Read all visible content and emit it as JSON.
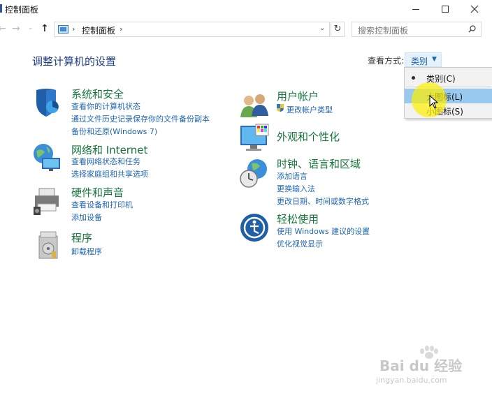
{
  "window": {
    "title": "控制面板"
  },
  "address": {
    "crumb": "控制面板",
    "search_placeholder": "搜索控制面板"
  },
  "header": {
    "title": "调整计算机的设置",
    "view_by_label": "查看方式:",
    "view_by_value": "类别"
  },
  "view_menu": {
    "items": [
      {
        "label": "类别(C)",
        "selected": true
      },
      {
        "label": "大图标(L)",
        "hovered": true
      },
      {
        "label": "小图标(S)"
      }
    ]
  },
  "categories": {
    "system": {
      "title": "系统和安全",
      "links": [
        "查看你的计算机状态",
        "通过文件历史记录保存你的文件备份副本",
        "备份和还原(Windows 7)"
      ]
    },
    "network": {
      "title": "网络和 Internet",
      "links": [
        "查看网络状态和任务",
        "选择家庭组和共享选项"
      ]
    },
    "hardware": {
      "title": "硬件和声音",
      "links": [
        "查看设备和打印机",
        "添加设备"
      ]
    },
    "programs": {
      "title": "程序",
      "links": [
        "卸载程序"
      ]
    },
    "accounts": {
      "title": "用户帐户",
      "links": [
        "更改帐户类型"
      ]
    },
    "appearance": {
      "title": "外观和个性化",
      "links": []
    },
    "clock": {
      "title": "时钟、语言和区域",
      "links": [
        "添加语言",
        "更换输入法",
        "更改日期、时间或数字格式"
      ]
    },
    "ease": {
      "title": "轻松使用",
      "links": [
        "使用 Windows 建议的设置",
        "优化视觉显示"
      ]
    }
  },
  "watermark": {
    "brand": "Bai du 经验",
    "url": "jingyan.baidu.com"
  },
  "colors": {
    "link": "#1e64b4",
    "category_title": "#16773a",
    "page_title": "#1f3c88",
    "menu_hover": "#99c9ef"
  }
}
